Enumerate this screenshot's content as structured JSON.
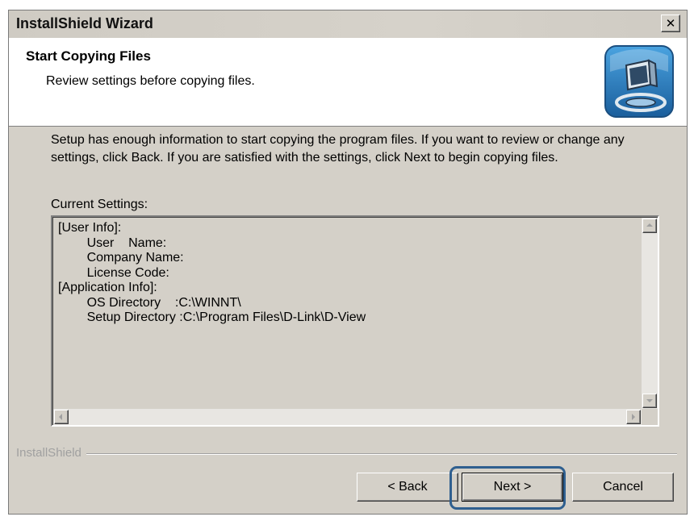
{
  "window": {
    "title": "InstallShield Wizard",
    "close_glyph": "✕"
  },
  "header": {
    "title": "Start Copying Files",
    "subtitle": "Review settings before copying files.",
    "icon": "setup-computer-icon"
  },
  "body": {
    "description": "Setup has enough information to start copying the program files.  If you want to review or change any settings, click Back.  If you are satisfied with the settings, click Next to begin copying files.",
    "settings_label": "Current Settings:",
    "settings_text": "[User Info]:\n        User    Name:\n        Company Name:\n        License Code:\n[Application Info]:\n        OS Directory    :C:\\WINNT\\\n        Setup Directory :C:\\Program Files\\D-Link\\D-View"
  },
  "footer": {
    "brand": "InstallShield",
    "back_label": "< Back",
    "next_label": "Next >",
    "cancel_label": "Cancel"
  },
  "colors": {
    "dialog_face": "#d4d0c8",
    "header_bg": "#ffffff",
    "highlight_ring": "#2f5f8f"
  }
}
